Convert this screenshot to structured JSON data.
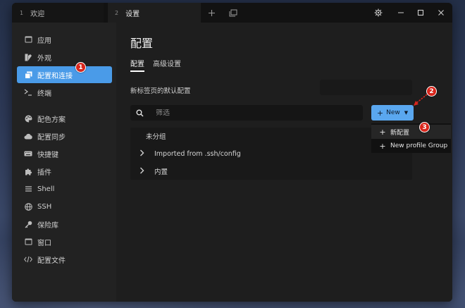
{
  "tabs": [
    {
      "num": "1",
      "label": "欢迎"
    },
    {
      "num": "2",
      "label": "设置"
    }
  ],
  "sidebar": {
    "items": [
      {
        "label": "应用",
        "icon": "app-window-icon"
      },
      {
        "label": "外观",
        "icon": "appearance-icon"
      },
      {
        "label": "配置和连接",
        "icon": "profiles-icon",
        "active": true
      },
      {
        "label": "终端",
        "icon": "terminal-icon"
      },
      {
        "label": "配色方案",
        "icon": "palette-icon"
      },
      {
        "label": "配置同步",
        "icon": "cloud-icon"
      },
      {
        "label": "快捷键",
        "icon": "keyboard-icon"
      },
      {
        "label": "插件",
        "icon": "puzzle-icon"
      },
      {
        "label": "Shell",
        "icon": "shell-icon"
      },
      {
        "label": "SSH",
        "icon": "globe-icon"
      },
      {
        "label": "保险库",
        "icon": "key-icon"
      },
      {
        "label": "窗口",
        "icon": "window-icon"
      },
      {
        "label": "配置文件",
        "icon": "code-icon"
      }
    ]
  },
  "main": {
    "title": "配置",
    "subtabs": [
      "配置",
      "高级设置"
    ],
    "default_profile_label": "新标签页的默认配置",
    "search_placeholder": "筛选",
    "new_button": "New",
    "groups": [
      {
        "label": "未分组",
        "expandable": false
      },
      {
        "label": "Imported from .ssh/config",
        "expandable": true
      },
      {
        "label": "内置",
        "expandable": true
      }
    ],
    "dropdown": [
      "新配置",
      "New profile Group"
    ]
  },
  "annotations": [
    "1",
    "2",
    "3"
  ],
  "colors": {
    "accent": "#4a9be8",
    "button": "#5aa7ef",
    "marker": "#d9261c"
  }
}
